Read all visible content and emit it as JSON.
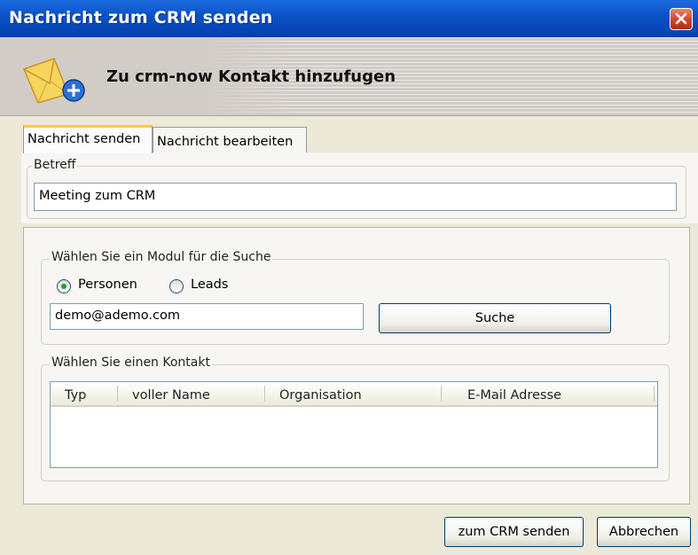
{
  "window": {
    "title": "Nachricht zum CRM senden"
  },
  "header": {
    "title": "Zu crm-now Kontakt hinzufugen",
    "icon": "mail-add-icon"
  },
  "tabs": [
    {
      "label": "Nachricht senden",
      "active": true
    },
    {
      "label": "Nachricht bearbeiten",
      "active": false
    }
  ],
  "subject": {
    "label": "Betreff",
    "value": "Meeting zum CRM"
  },
  "search": {
    "group_label": "Wählen Sie ein Modul für die Suche",
    "options": [
      {
        "label": "Personen",
        "checked": true
      },
      {
        "label": "Leads",
        "checked": false
      }
    ],
    "query": "demo@ademo.com",
    "button": "Suche"
  },
  "contacts": {
    "group_label": "Wählen Sie einen Kontakt",
    "columns": [
      "Typ",
      "voller Name",
      "Organisation",
      "E-Mail Adresse"
    ],
    "rows": []
  },
  "footer": {
    "send_label": "zum CRM senden",
    "cancel_label": "Abbrechen"
  },
  "colors": {
    "titlebar": "#0a53c7",
    "close": "#d2452a",
    "tab_accent": "#ffc842",
    "radio_checked": "#21a121"
  }
}
